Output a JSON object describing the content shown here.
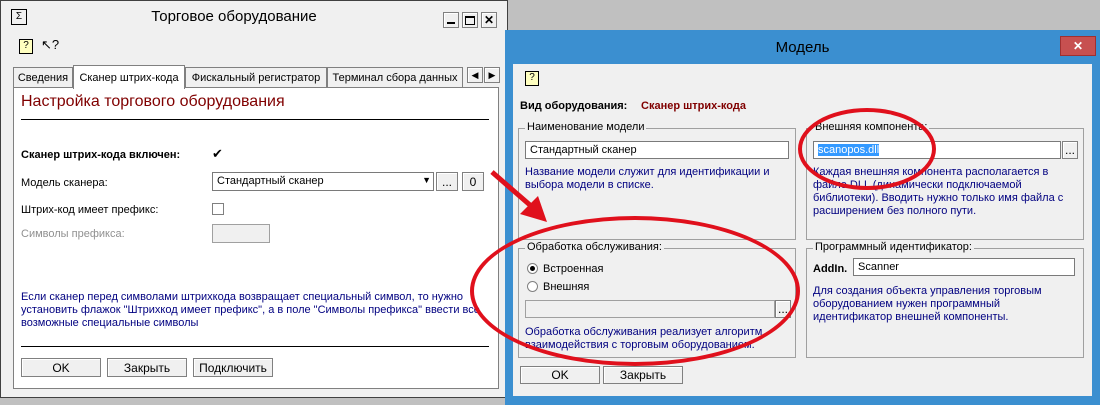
{
  "left_window": {
    "title": "Торговое оборудование",
    "tabs": [
      "Сведения",
      "Сканер штрих-кода",
      "Фискальный регистратор",
      "Терминал сбора данных"
    ],
    "heading": "Настройка торгового оборудования",
    "scanner_enabled_label": "Сканер штрих-кода включен:",
    "model_label": "Модель сканера:",
    "model_value": "Стандартный сканер",
    "prefix_label": "Штрих-код имеет префикс:",
    "prefix_chars_label": "Символы префикса:",
    "info_text_1": "Если сканер перед символами штрихкода возвращает специальный символ, то нужно",
    "info_text_2": "установить флажок \"Штрихкод имеет префикс\", а в поле \"Символы префикса\" ввести все",
    "info_text_3": "возможные специальные символы",
    "ok_label": "OK",
    "close_label": "Закрыть",
    "connect_label": "Подключить",
    "ellipsis": "...",
    "zero_btn": "0"
  },
  "right_window": {
    "title": "Модель",
    "equip_type_label": "Вид оборудования:",
    "equip_type_value": "Сканер штрих-кода",
    "model_name_legend": "Наименование модели",
    "model_name_value": "Стандартный сканер",
    "model_name_help_1": "Название модели служит для идентификации и",
    "model_name_help_2": "выбора модели в списке.",
    "ext_component_legend": "Внешняя компонента:",
    "ext_component_value": "scanopos.dll",
    "ext_help_1": "Каждая внешняя компонента располагается в",
    "ext_help_2": "файле DLL (динамически подключаемой",
    "ext_help_3": "библиотеки). Вводить нужно только имя файла с",
    "ext_help_4": "расширением без полного пути.",
    "service_legend": "Обработка обслуживания:",
    "radio_builtin": "Встроенная",
    "radio_external": "Внешняя",
    "service_help_1": "Обработка обслуживания реализует алгоритм",
    "service_help_2": "взаимодействия с торговым оборудованием.",
    "prog_id_legend": "Программный идентификатор:",
    "addin_label": "AddIn.",
    "addin_value": "Scanner",
    "prog_help_1": "Для создания объекта управления торговым",
    "prog_help_2": "оборудованием нужен программный",
    "prog_help_3": "идентификатор внешней компоненты.",
    "ok_label": "OK",
    "close_label": "Закрыть",
    "ellipsis": "..."
  },
  "colors": {
    "accent_red": "#e0101c",
    "heading_dark_red": "#800000",
    "help_blue": "#000080",
    "selection": "#3399ff"
  }
}
